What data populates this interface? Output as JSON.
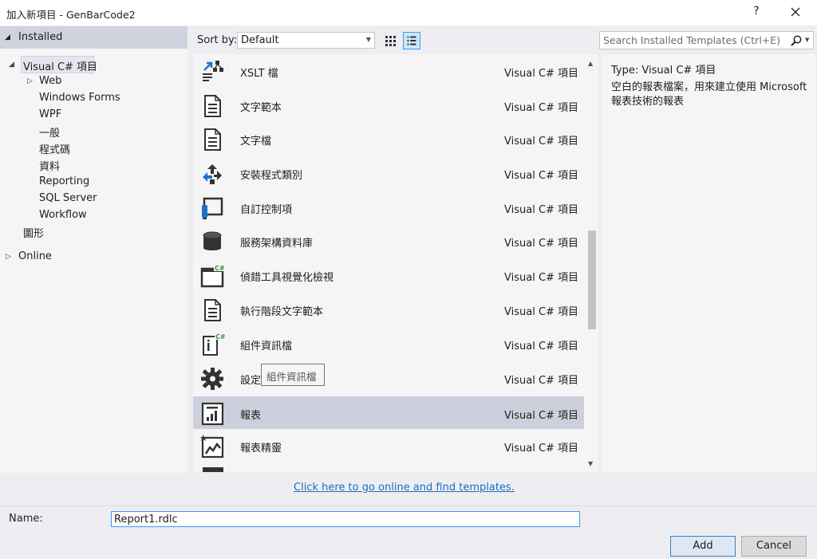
{
  "window": {
    "title": "加入新項目 - GenBarCode2",
    "help_label": "?"
  },
  "tree": {
    "header": "Installed",
    "items": [
      {
        "label": "Visual C# 項目",
        "level": 1,
        "expanded": true,
        "selected": true
      },
      {
        "label": "Web",
        "level": 2,
        "expandable": true
      },
      {
        "label": "Windows Forms",
        "level": 2
      },
      {
        "label": "WPF",
        "level": 2
      },
      {
        "label": "一般",
        "level": 2
      },
      {
        "label": "程式碼",
        "level": 2
      },
      {
        "label": "資料",
        "level": 2
      },
      {
        "label": "Reporting",
        "level": 2
      },
      {
        "label": "SQL Server",
        "level": 2
      },
      {
        "label": "Workflow",
        "level": 2
      },
      {
        "label": "圖形",
        "level": 1
      }
    ],
    "online": "Online"
  },
  "toolbar": {
    "sort_label": "Sort by:",
    "sort_value": "Default",
    "search_placeholder": "Search Installed Templates (Ctrl+E)"
  },
  "templates": [
    {
      "name": "XSLT 檔",
      "type": "Visual C# 項目",
      "icon": "xslt-icon"
    },
    {
      "name": "文字範本",
      "type": "Visual C# 項目",
      "icon": "text-template-icon"
    },
    {
      "name": "文字檔",
      "type": "Visual C# 項目",
      "icon": "text-file-icon"
    },
    {
      "name": "安裝程式類別",
      "type": "Visual C# 項目",
      "icon": "installer-class-icon"
    },
    {
      "name": "自訂控制項",
      "type": "Visual C# 項目",
      "icon": "custom-control-icon"
    },
    {
      "name": "服務架構資料庫",
      "type": "Visual C# 項目",
      "icon": "database-icon"
    },
    {
      "name": "偵錯工具視覺化檢視",
      "type": "Visual C# 項目",
      "icon": "debugger-visualizer-icon"
    },
    {
      "name": "執行階段文字範本",
      "type": "Visual C# 項目",
      "icon": "runtime-text-template-icon"
    },
    {
      "name": "組件資訊檔",
      "type": "Visual C# 項目",
      "icon": "assembly-info-icon"
    },
    {
      "name": "設定",
      "type": "Visual C# 項目",
      "icon": "settings-icon"
    },
    {
      "name": "報表",
      "type": "Visual C# 項目",
      "icon": "report-icon",
      "selected": true
    },
    {
      "name": "報表精靈",
      "type": "Visual C# 項目",
      "icon": "report-wizard-icon"
    }
  ],
  "tooltip": "組件資訊檔",
  "details": {
    "type_label": "Type:",
    "type_value": "Visual C# 項目",
    "description": "空白的報表檔案，用來建立使用 Microsoft 報表技術的報表"
  },
  "online_link": "Click here to go online and find templates.",
  "name_field": {
    "label": "Name:",
    "value": "Report1.rdlc"
  },
  "buttons": {
    "add": "Add",
    "cancel": "Cancel"
  }
}
